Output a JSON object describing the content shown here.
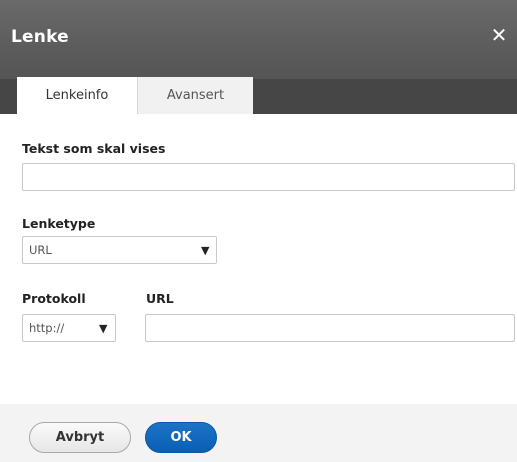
{
  "dialog": {
    "title": "Lenke",
    "close_glyph": "✕"
  },
  "tabs": [
    {
      "label": "Lenkeinfo",
      "active": true
    },
    {
      "label": "Avansert",
      "active": false
    }
  ],
  "form": {
    "display_text": {
      "label": "Tekst som skal vises",
      "value": ""
    },
    "link_type": {
      "label": "Lenketype",
      "selected": "URL"
    },
    "protocol": {
      "label": "Protokoll",
      "selected": "http://"
    },
    "url": {
      "label": "URL",
      "value": ""
    }
  },
  "footer": {
    "cancel_label": "Avbryt",
    "ok_label": "OK"
  },
  "colors": {
    "titlebar": "#5c5c5c",
    "tabstrip": "#464646",
    "ok_button": "#0a5fb4"
  },
  "icons": {
    "close": "close-icon",
    "dropdown": "chevron-down-icon"
  }
}
